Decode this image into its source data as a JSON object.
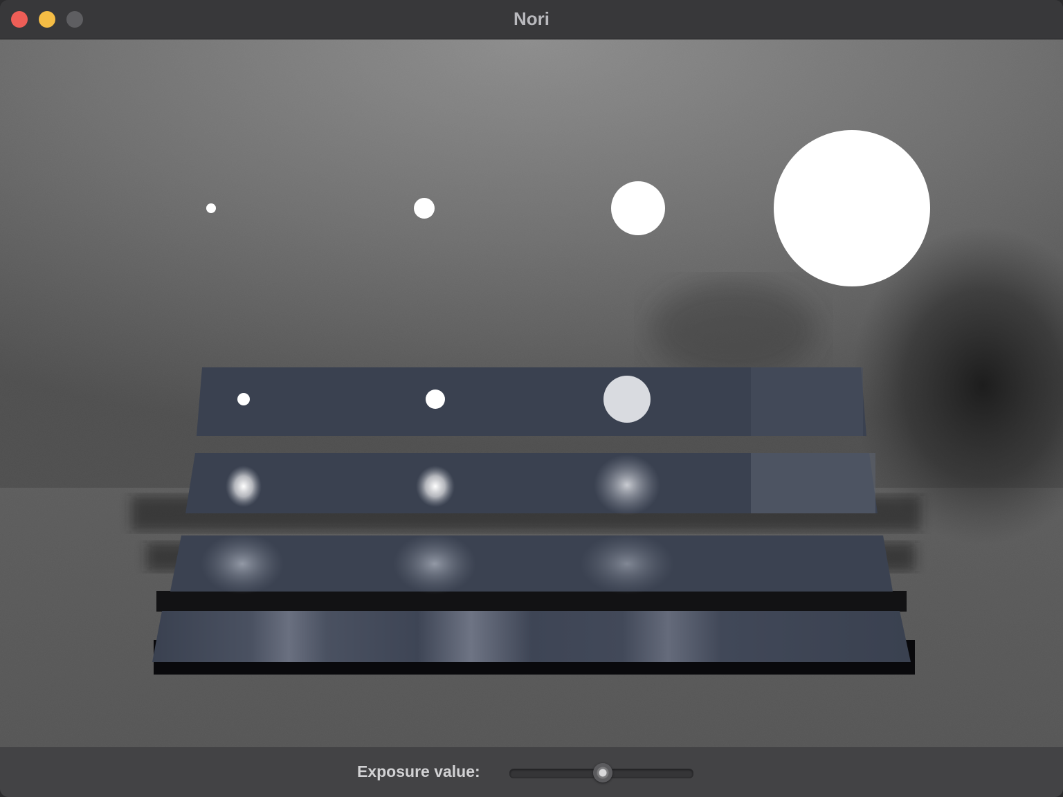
{
  "window": {
    "title": "Nori"
  },
  "controls": {
    "exposure_label": "Exposure value:",
    "exposure_slider_fraction": 0.5
  },
  "colors": {
    "close": "#ee5e57",
    "minimize": "#f5bd45",
    "maximize_inactive": "#5e5e61",
    "plate": "#3a4150"
  }
}
